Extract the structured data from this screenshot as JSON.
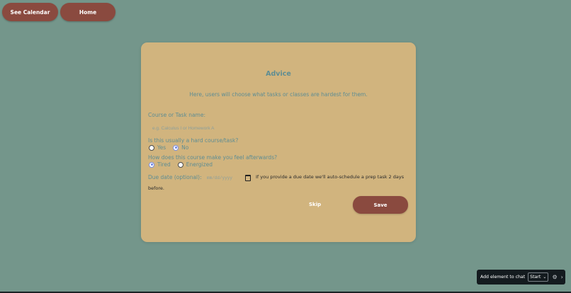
{
  "nav": {
    "calendar_label": "See Calendar",
    "home_label": "Home"
  },
  "card": {
    "title": "Advice",
    "subtitle": "Here, users will choose what tasks or classes are hardest for them.",
    "course_label": "Course or Task name:",
    "course_placeholder": "e.g. Calculus I or Homework A",
    "course_value": "",
    "hard_question": "Is this usually a hard course/task?",
    "hard_options": [
      "Yes",
      "No"
    ],
    "hard_selected": "No",
    "feel_question": "How does this course make you feel afterwards?",
    "feel_options": [
      "Tired",
      "Energized"
    ],
    "feel_selected": "Tired",
    "due_label": "Due date (optional):",
    "due_placeholder": "mm/dd/yyyy",
    "due_note_line1": "If you provide a due date we'll auto-schedule a prep task 2 days",
    "due_note_line2": "before.",
    "skip_label": "Skip",
    "save_label": "Save"
  },
  "chat_widget": {
    "label": "Add element to chat",
    "select_value": "Start",
    "settings_icon": "gear-icon",
    "next_icon": "chevron-right-icon"
  },
  "colors": {
    "background": "#74968b",
    "card": "#d1b47e",
    "button": "#8a4a3f",
    "text_accent": "#5e8d93"
  }
}
